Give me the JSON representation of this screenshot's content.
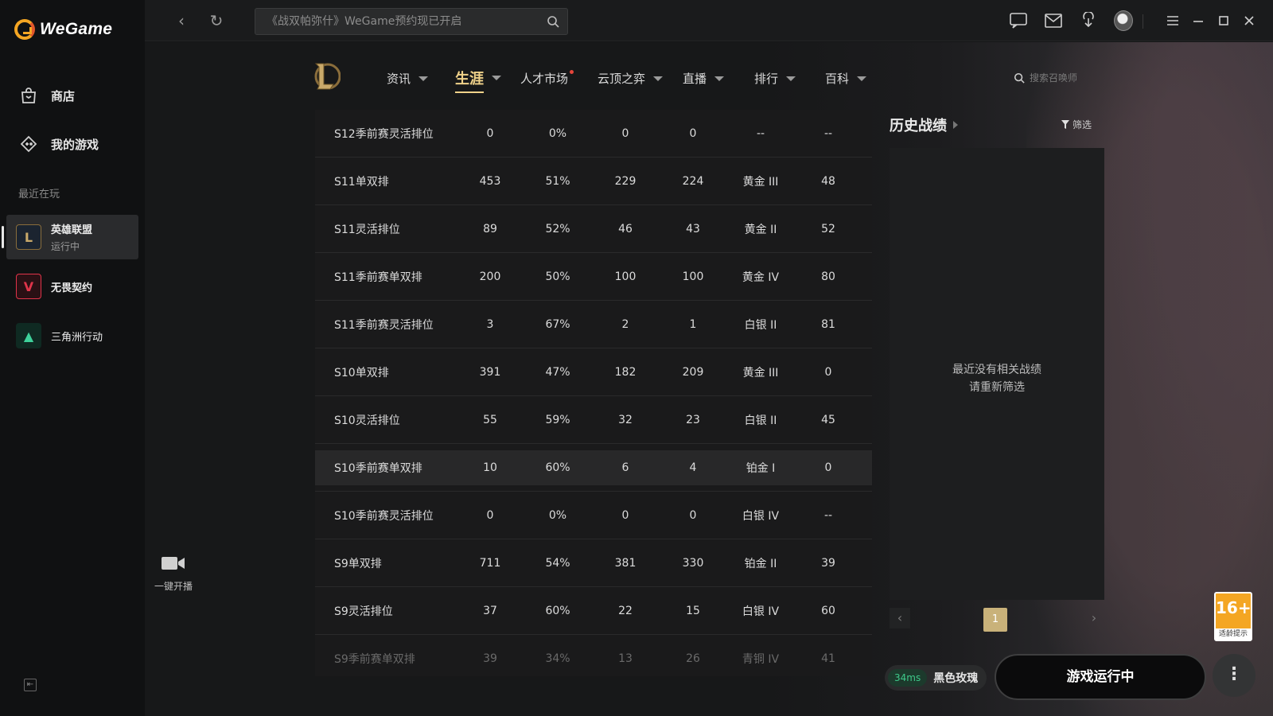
{
  "app": {
    "brand": "WeGame"
  },
  "sidebar": {
    "store_label": "商店",
    "my_games_label": "我的游戏",
    "recent_title": "最近在玩",
    "games": [
      {
        "name": "英雄联盟",
        "status": "运行中"
      },
      {
        "name": "无畏契约",
        "status": ""
      },
      {
        "name": "三角洲行动",
        "status": ""
      }
    ]
  },
  "topbar": {
    "search_placeholder": "《战双帕弥什》WeGame预约现已开启"
  },
  "game_nav": {
    "tabs": [
      {
        "label": "资讯",
        "has_caret": true
      },
      {
        "label": "生涯",
        "has_caret": true,
        "active": true
      },
      {
        "label": "人才市场",
        "has_caret": false,
        "has_dot": true
      },
      {
        "label": "云顶之弈",
        "has_caret": true
      },
      {
        "label": "直播",
        "has_caret": true
      },
      {
        "label": "排行",
        "has_caret": true
      },
      {
        "label": "百科",
        "has_caret": true
      }
    ],
    "summoner_search_placeholder": "搜索召唤师"
  },
  "broadcast": {
    "label": "一键开播"
  },
  "records": {
    "rows": [
      {
        "queue": "S12季前赛灵活排位",
        "games": "0",
        "winrate": "0%",
        "wins": "0",
        "losses": "0",
        "tier": "--",
        "lp": "--"
      },
      {
        "queue": "S11单双排",
        "games": "453",
        "winrate": "51%",
        "wins": "229",
        "losses": "224",
        "tier": "黄金 III",
        "lp": "48"
      },
      {
        "queue": "S11灵活排位",
        "games": "89",
        "winrate": "52%",
        "wins": "46",
        "losses": "43",
        "tier": "黄金 II",
        "lp": "52"
      },
      {
        "queue": "S11季前赛单双排",
        "games": "200",
        "winrate": "50%",
        "wins": "100",
        "losses": "100",
        "tier": "黄金 IV",
        "lp": "80"
      },
      {
        "queue": "S11季前赛灵活排位",
        "games": "3",
        "winrate": "67%",
        "wins": "2",
        "losses": "1",
        "tier": "白银 II",
        "lp": "81"
      },
      {
        "queue": "S10单双排",
        "games": "391",
        "winrate": "47%",
        "wins": "182",
        "losses": "209",
        "tier": "黄金 III",
        "lp": "0"
      },
      {
        "queue": "S10灵活排位",
        "games": "55",
        "winrate": "59%",
        "wins": "32",
        "losses": "23",
        "tier": "白银 II",
        "lp": "45"
      },
      {
        "queue": "S10季前赛单双排",
        "games": "10",
        "winrate": "60%",
        "wins": "6",
        "losses": "4",
        "tier": "铂金 I",
        "lp": "0"
      },
      {
        "queue": "S10季前赛灵活排位",
        "games": "0",
        "winrate": "0%",
        "wins": "0",
        "losses": "0",
        "tier": "白银 IV",
        "lp": "--"
      },
      {
        "queue": "S9单双排",
        "games": "711",
        "winrate": "54%",
        "wins": "381",
        "losses": "330",
        "tier": "铂金 II",
        "lp": "39"
      },
      {
        "queue": "S9灵活排位",
        "games": "37",
        "winrate": "60%",
        "wins": "22",
        "losses": "15",
        "tier": "白银 IV",
        "lp": "60"
      },
      {
        "queue": "S9季前赛单双排",
        "games": "39",
        "winrate": "34%",
        "wins": "13",
        "losses": "26",
        "tier": "青铜 IV",
        "lp": "41"
      }
    ]
  },
  "history": {
    "title": "历史战绩",
    "filter_label": "筛选",
    "empty_line1": "最近没有相关战绩",
    "empty_line2": "请重新筛选",
    "current_page": "1"
  },
  "status": {
    "ping": "34ms",
    "server": "黑色玫瑰",
    "run_button": "游戏运行中",
    "age_rating": "16+",
    "age_note": "适龄提示"
  },
  "colors": {
    "accent_gold": "#f0d28a",
    "ping_green": "#3ec98a",
    "age_badge": "#f4a623"
  }
}
